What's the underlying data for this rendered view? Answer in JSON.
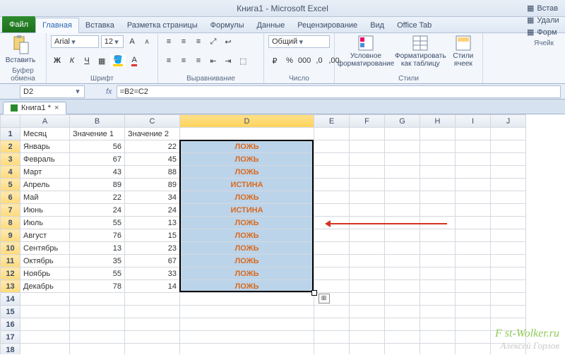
{
  "title": "Книга1 - Microsoft Excel",
  "file_label": "Файл",
  "tabs": [
    "Главная",
    "Вставка",
    "Разметка страницы",
    "Формулы",
    "Данные",
    "Рецензирование",
    "Вид",
    "Office Tab"
  ],
  "ribbon": {
    "clipboard": {
      "paste": "Вставить",
      "group": "Буфер обмена"
    },
    "font": {
      "name": "Arial",
      "size": "12",
      "group": "Шрифт"
    },
    "align": {
      "group": "Выравнивание"
    },
    "number": {
      "format": "Общий",
      "group": "Число"
    },
    "styles": {
      "cond": "Условное форматирование",
      "table": "Форматировать как таблицу",
      "cell": "Стили ячеек",
      "group": "Стили"
    },
    "cells": {
      "insert": "Встав",
      "delete": "Удали",
      "format": "Форм",
      "group": "Ячейк"
    }
  },
  "namebox": "D2",
  "formula": "=B2=C2",
  "wbtab": "Книга1 *",
  "columns": [
    "A",
    "B",
    "C",
    "D",
    "E",
    "F",
    "G",
    "H",
    "I",
    "J"
  ],
  "headers": {
    "A": "Месяц",
    "B": "Значение 1",
    "C": "Значение 2"
  },
  "rows": [
    {
      "n": 1,
      "A": "Месяц",
      "B": "Значение 1",
      "C": "Значение 2",
      "D": ""
    },
    {
      "n": 2,
      "A": "Январь",
      "B": 56,
      "C": 22,
      "D": "ЛОЖЬ"
    },
    {
      "n": 3,
      "A": "Февраль",
      "B": 67,
      "C": 45,
      "D": "ЛОЖЬ"
    },
    {
      "n": 4,
      "A": "Март",
      "B": 43,
      "C": 88,
      "D": "ЛОЖЬ"
    },
    {
      "n": 5,
      "A": "Апрель",
      "B": 89,
      "C": 89,
      "D": "ИСТИНА"
    },
    {
      "n": 6,
      "A": "Май",
      "B": 22,
      "C": 34,
      "D": "ЛОЖЬ"
    },
    {
      "n": 7,
      "A": "Июнь",
      "B": 24,
      "C": 24,
      "D": "ИСТИНА"
    },
    {
      "n": 8,
      "A": "Июль",
      "B": 55,
      "C": 13,
      "D": "ЛОЖЬ"
    },
    {
      "n": 9,
      "A": "Август",
      "B": 76,
      "C": 15,
      "D": "ЛОЖЬ"
    },
    {
      "n": 10,
      "A": "Сентябрь",
      "B": 13,
      "C": 23,
      "D": "ЛОЖЬ"
    },
    {
      "n": 11,
      "A": "Октябрь",
      "B": 35,
      "C": 67,
      "D": "ЛОЖЬ"
    },
    {
      "n": 12,
      "A": "Ноябрь",
      "B": 55,
      "C": 33,
      "D": "ЛОЖЬ"
    },
    {
      "n": 13,
      "A": "Декабрь",
      "B": 78,
      "C": 14,
      "D": "ЛОЖЬ"
    }
  ],
  "empty_rows": [
    14,
    15,
    16,
    17,
    18
  ],
  "watermark1": "F  st-Wolker.ru",
  "watermark2": "Алексей Горлов"
}
